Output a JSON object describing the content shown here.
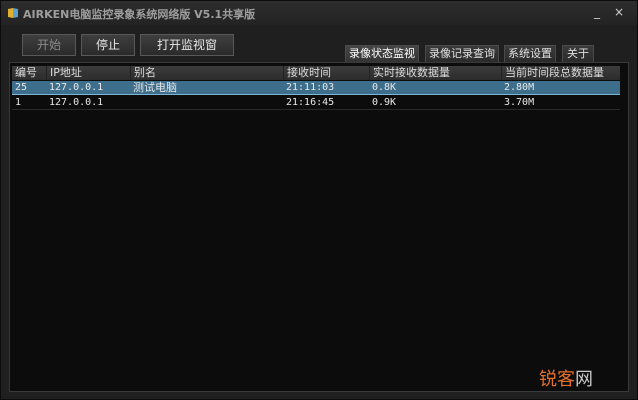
{
  "window": {
    "title": "AIRKEN电脑监控录象系统网络版 V5.1共享版",
    "minimize_glyph": "_",
    "close_glyph": "×"
  },
  "toolbar": {
    "start_label": "开始",
    "stop_label": "停止",
    "open_monitor_label": "打开监视窗"
  },
  "tabs": [
    {
      "label": "录像状态监视",
      "active": true
    },
    {
      "label": "录像记录查询",
      "active": false
    },
    {
      "label": "系统设置",
      "active": false
    },
    {
      "label": "关于",
      "active": false
    }
  ],
  "table": {
    "columns": [
      "编号",
      "IP地址",
      "别名",
      "接收时间",
      "实时接收数据量",
      "当前时间段总数据量"
    ],
    "rows": [
      {
        "id": "25",
        "ip": "127.0.0.1",
        "alias": "测试电脑",
        "time": "21:11:03",
        "realtime": "0.8K",
        "total": "2.80M",
        "selected": true
      },
      {
        "id": "1",
        "ip": "127.0.0.1",
        "alias": "",
        "time": "21:16:45",
        "realtime": "0.9K",
        "total": "3.70M",
        "selected": false
      }
    ]
  },
  "watermark": {
    "part1": "锐客",
    "part2": "网"
  },
  "colors": {
    "selected_row": "#3d6e8c",
    "background": "#1f1f1f",
    "watermark": "#e0702a"
  }
}
